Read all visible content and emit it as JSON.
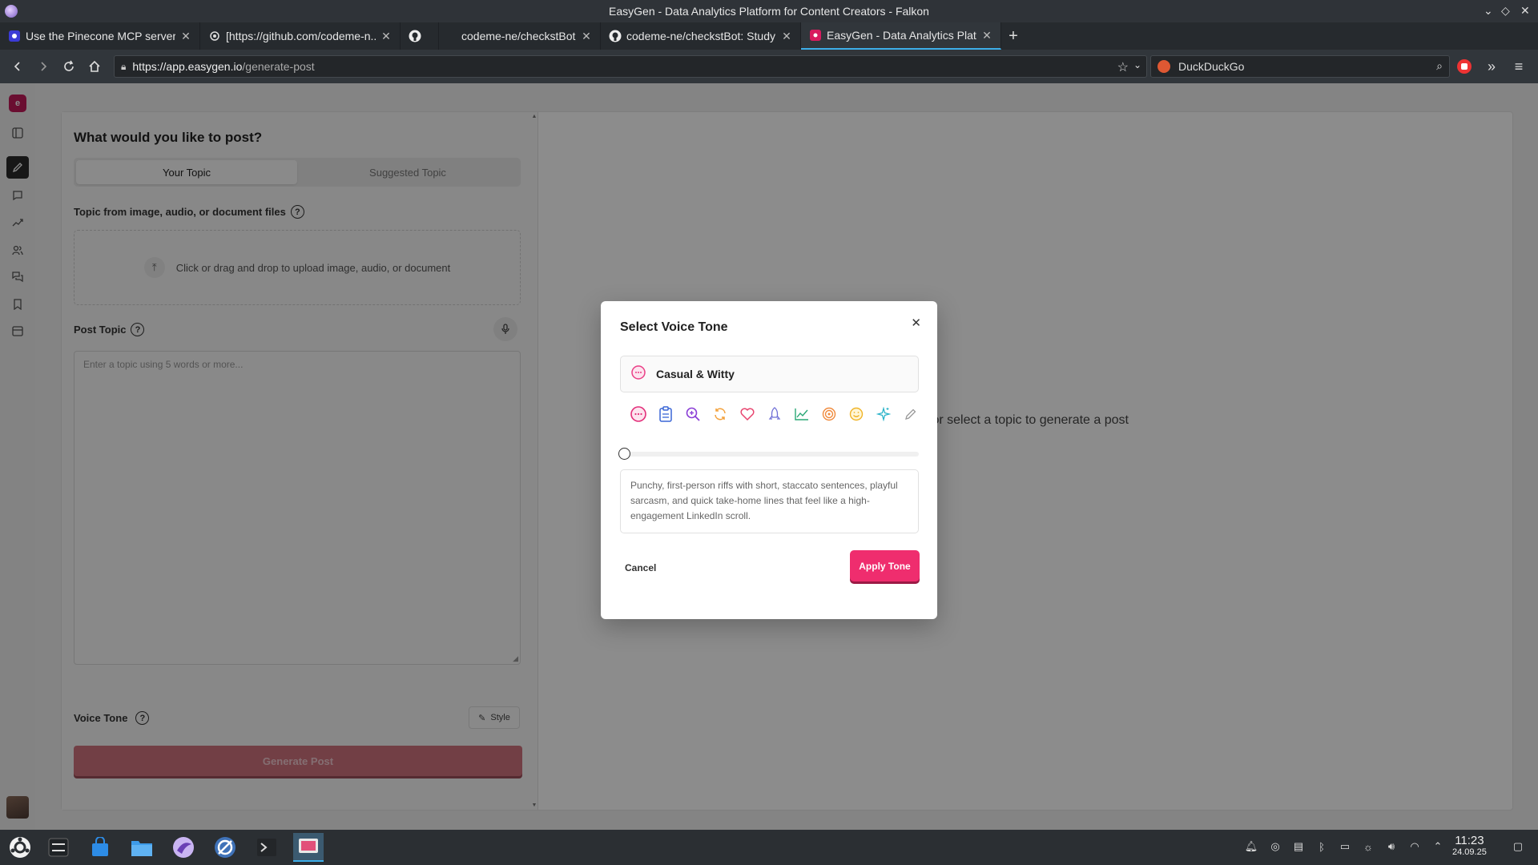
{
  "window": {
    "title": "EasyGen - Data Analytics Platform for Content Creators - Falkon"
  },
  "tabs": [
    {
      "title": "Use the Pinecone MCP server -...",
      "icon": "pinecone-icon"
    },
    {
      "title": "[https://github.com/codeme-n...",
      "icon": "bug-icon"
    },
    {
      "title": "",
      "icon": "github-icon"
    },
    {
      "title": "codeme-ne/checkstBot",
      "icon": "none"
    },
    {
      "title": "codeme-ne/checkstBot: Study ...",
      "icon": "github-icon"
    },
    {
      "title": "EasyGen - Data Analytics Platf...",
      "icon": "easygen-icon",
      "active": true
    }
  ],
  "nav": {
    "url_host": "https://app.easygen.io",
    "url_path": "/generate-post",
    "search_engine": "DuckDuckGo"
  },
  "app": {
    "logo_letter": "e",
    "page_title": "What would you like to post?",
    "segments": [
      "Your Topic",
      "Suggested Topic"
    ],
    "files_label": "Topic from image, audio, or document files",
    "upload_text": "Click or drag and drop to upload image, audio, or document",
    "post_topic_label": "Post Topic",
    "topic_placeholder": "Enter a topic using 5 words or more...",
    "voice_tone_label": "Voice Tone",
    "style_button": "Style",
    "generate_button": "Generate Post",
    "empty_message": "Create or select a topic to generate a post"
  },
  "modal": {
    "title": "Select Voice Tone",
    "selected_tone": "Casual & Witty",
    "tone_icons": [
      "chat-icon",
      "clipboard-icon",
      "zoom-icon",
      "refresh-icon",
      "heart-icon",
      "rocket-icon",
      "chart-icon",
      "target-icon",
      "smile-icon",
      "sparkle-icon",
      "pencil-icon"
    ],
    "slider_level": 0,
    "description": "Punchy, first-person riffs with short, staccato sentences, playful sarcasm, and quick take-home lines that feel like a high-engagement LinkedIn scroll.",
    "cancel": "Cancel",
    "apply": "Apply Tone"
  },
  "taskbar": {
    "time": "11:23",
    "date": "24.09.25"
  },
  "colors": {
    "brand": "#c21a59",
    "apply": "#ef2d6e",
    "generate_disabled": "#d0747f"
  }
}
